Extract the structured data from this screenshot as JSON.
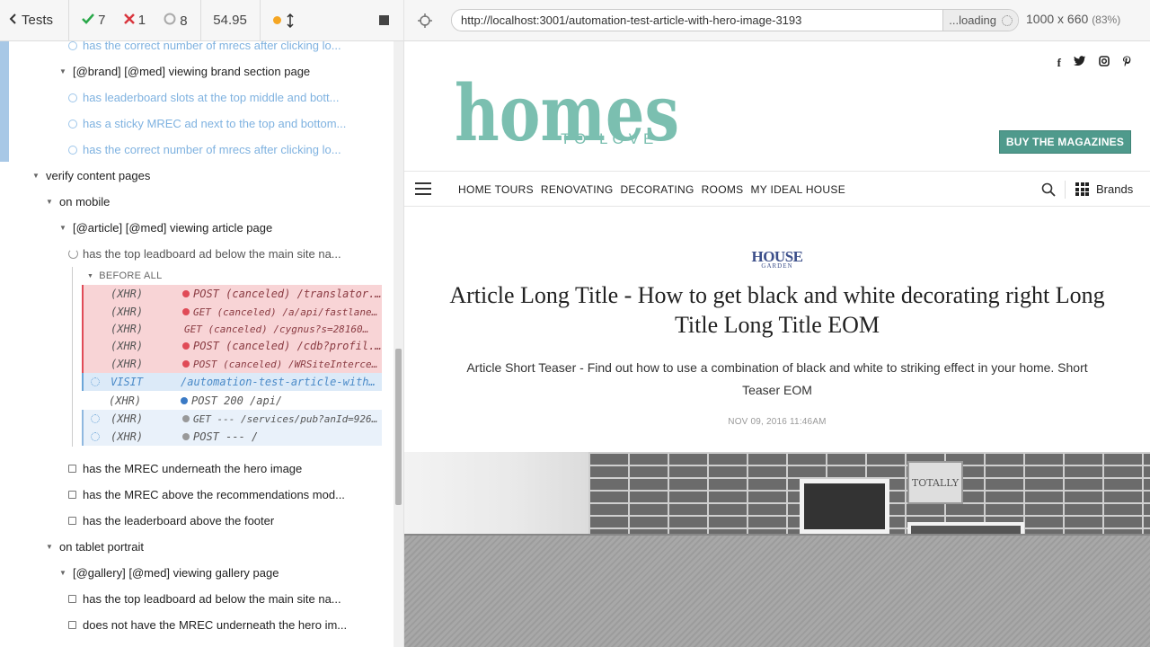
{
  "runner": {
    "tests_label": "Tests",
    "passed": "7",
    "failed": "1",
    "pending": "8",
    "duration": "54.95",
    "tree": [
      {
        "text": "has the correct number of mrecs after clicking lo...",
        "state": "pending"
      },
      {
        "text": "[@brand] [@med] viewing brand section page",
        "state": "suite"
      },
      {
        "text": "has leaderboard slots at the top middle and bott...",
        "state": "pending"
      },
      {
        "text": "has a sticky MREC ad next to the top and bottom...",
        "state": "pending"
      },
      {
        "text": "has the correct number of mrecs after clicking lo...",
        "state": "pending"
      },
      {
        "text": "verify content pages",
        "state": "suite"
      },
      {
        "text": "on mobile",
        "state": "suite"
      },
      {
        "text": "[@article] [@med] viewing article page",
        "state": "suite"
      },
      {
        "text": "has the top leadboard ad below the main site na...",
        "state": "running"
      },
      {
        "text": "has the MREC underneath the hero image",
        "state": "queued"
      },
      {
        "text": "has the MREC above the recommendations mod...",
        "state": "queued"
      },
      {
        "text": "has the leaderboard above the footer",
        "state": "queued"
      },
      {
        "text": "on tablet portrait",
        "state": "suite"
      },
      {
        "text": "[@gallery] [@med] viewing gallery page",
        "state": "suite"
      },
      {
        "text": "has the top leadboard ad below the main site na...",
        "state": "queued"
      },
      {
        "text": "does not have the MREC underneath the hero im...",
        "state": "queued"
      }
    ],
    "before_all": "BEFORE ALL",
    "commands": [
      {
        "kind": "(XHR)",
        "msg": "POST (canceled) /translator...",
        "type": "failed",
        "dot": "red",
        "size": "normal"
      },
      {
        "kind": "(XHR)",
        "msg": "GET (canceled) /a/api/fastlane.j...",
        "type": "failed",
        "dot": "red",
        "size": "small"
      },
      {
        "kind": "(XHR)",
        "msg": "GET (canceled) /cygnus?s=281608&...",
        "type": "failed",
        "dot": "",
        "size": "small"
      },
      {
        "kind": "(XHR)",
        "msg": "POST (canceled) /cdb?profil...",
        "type": "failed",
        "dot": "red",
        "size": "normal"
      },
      {
        "kind": "(XHR)",
        "msg": "POST (canceled) /WRSiteIntercept...",
        "type": "failed",
        "dot": "red",
        "size": "small"
      },
      {
        "kind": "VISIT",
        "msg": "/automation-test-article-with...",
        "type": "visit",
        "dot": "",
        "size": "normal"
      },
      {
        "kind": "(XHR)",
        "msg": "POST 200 /api/",
        "type": "plain",
        "dot": "blue",
        "size": "normal"
      },
      {
        "kind": "(XHR)",
        "msg": "GET --- /services/pub?anId=92692...",
        "type": "light",
        "dot": "gray",
        "size": "small"
      },
      {
        "kind": "(XHR)",
        "msg": "POST --- /",
        "type": "light",
        "dot": "gray",
        "size": "normal"
      }
    ]
  },
  "aut": {
    "url": "http://localhost:3001/automation-test-article-with-hero-image-3193",
    "loading": "...loading",
    "viewport": "1000 x 660",
    "scale": "(83%)"
  },
  "site": {
    "logo_main": "homes",
    "logo_sub": "TO LOVE",
    "brand_color": "#7bbfb0",
    "social": [
      "f",
      "twitter-icon",
      "instagram-icon",
      "pinterest-icon"
    ],
    "buy_button": "BUY THE MAGAZINES",
    "nav": [
      "HOME TOURS",
      "RENOVATING",
      "DECORATING",
      "ROOMS",
      "MY IDEAL HOUSE"
    ],
    "brands_label": "Brands",
    "hg_logo_top": "HOUSE",
    "hg_logo_bottom": "GARDEN",
    "article_title": "Article Long Title - How to get black and white decorating right Long Title Long Title EOM",
    "article_teaser": "Article Short Teaser - Find out how to use a combination of black and white to striking effect in your home. Short Teaser EOM",
    "article_date": "NOV 09, 2016 11:46AM",
    "hero_sign": "TOTALLY"
  }
}
